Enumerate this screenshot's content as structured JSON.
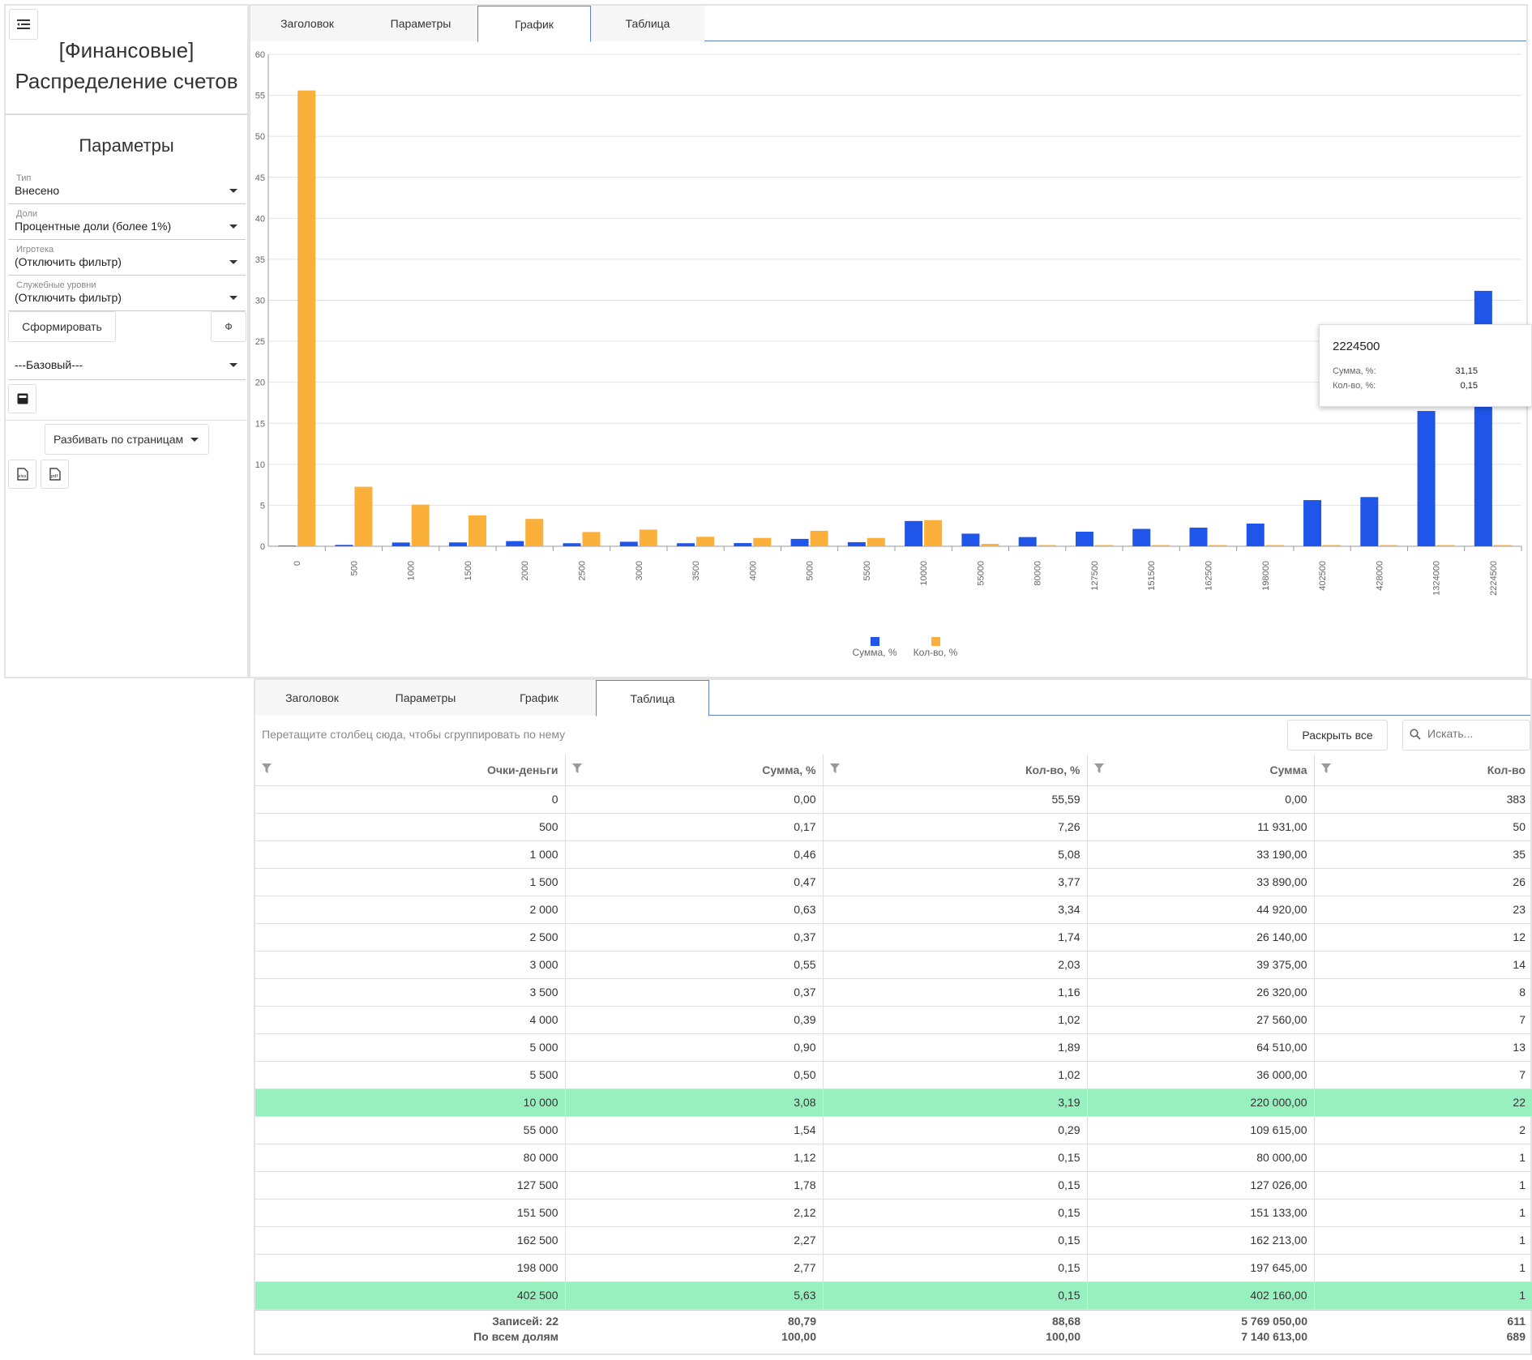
{
  "left": {
    "title_line1": "[Финансовые]",
    "title_line2": "Распределение счетов",
    "params_heading": "Параметры",
    "fields": [
      {
        "label": "Тип",
        "value": "Внесено"
      },
      {
        "label": "Доли",
        "value": "Процентные доли (более 1%)"
      },
      {
        "label": "Игротека",
        "value": "(Отключить фильтр)"
      },
      {
        "label": "Служебные уровни",
        "value": "(Отключить фильтр)"
      }
    ],
    "generate_label": "Сформировать",
    "phi_label": "Ф",
    "preset_value": "---Базовый---",
    "paging_label": "Разбивать по страницам"
  },
  "tabs": [
    "Заголовок",
    "Параметры",
    "График",
    "Таблица"
  ],
  "chart_data": {
    "type": "bar",
    "categories": [
      "0",
      "500",
      "1000",
      "1500",
      "2000",
      "2500",
      "3000",
      "3500",
      "4000",
      "5000",
      "5500",
      "10000",
      "55000",
      "80000",
      "127500",
      "151500",
      "162500",
      "198000",
      "402500",
      "428000",
      "1324000",
      "2224500"
    ],
    "series": [
      {
        "name": "Сумма, %",
        "color": "#1f55e8",
        "values": [
          0,
          0.17,
          0.46,
          0.47,
          0.63,
          0.37,
          0.55,
          0.37,
          0.39,
          0.9,
          0.5,
          3.08,
          1.54,
          1.12,
          1.78,
          2.12,
          2.27,
          2.77,
          5.63,
          6.0,
          16.5,
          31.15
        ]
      },
      {
        "name": "Кол-во, %",
        "color": "#fbb03b",
        "values": [
          55.59,
          7.26,
          5.08,
          3.77,
          3.34,
          1.74,
          2.03,
          1.16,
          1.02,
          1.89,
          1.02,
          3.19,
          0.29,
          0.15,
          0.15,
          0.15,
          0.15,
          0.15,
          0.15,
          0.15,
          0.15,
          0.15
        ]
      }
    ],
    "ylim": [
      0,
      60
    ],
    "yticks": [
      0,
      5,
      10,
      15,
      20,
      25,
      30,
      35,
      40,
      45,
      50,
      55,
      60
    ],
    "legend": "bottom-center",
    "grid": true
  },
  "tooltip": {
    "title": "2224500",
    "rows": [
      {
        "label": "Сумма, %:",
        "value": "31,15"
      },
      {
        "label": "Кол-во, %:",
        "value": "0,15"
      }
    ]
  },
  "table": {
    "group_hint": "Перетащите столбец сюда, чтобы сгруппировать по нему",
    "expand_label": "Раскрыть все",
    "search_placeholder": "Искать...",
    "columns": [
      "Очки-деньги",
      "Сумма, %",
      "Кол-во, %",
      "Сумма",
      "Кол-во"
    ],
    "rows": [
      [
        "0",
        "0,00",
        "55,59",
        "0,00",
        "383"
      ],
      [
        "500",
        "0,17",
        "7,26",
        "11 931,00",
        "50"
      ],
      [
        "1 000",
        "0,46",
        "5,08",
        "33 190,00",
        "35"
      ],
      [
        "1 500",
        "0,47",
        "3,77",
        "33 890,00",
        "26"
      ],
      [
        "2 000",
        "0,63",
        "3,34",
        "44 920,00",
        "23"
      ],
      [
        "2 500",
        "0,37",
        "1,74",
        "26 140,00",
        "12"
      ],
      [
        "3 000",
        "0,55",
        "2,03",
        "39 375,00",
        "14"
      ],
      [
        "3 500",
        "0,37",
        "1,16",
        "26 320,00",
        "8"
      ],
      [
        "4 000",
        "0,39",
        "1,02",
        "27 560,00",
        "7"
      ],
      [
        "5 000",
        "0,90",
        "1,89",
        "64 510,00",
        "13"
      ],
      [
        "5 500",
        "0,50",
        "1,02",
        "36 000,00",
        "7"
      ],
      [
        "10 000",
        "3,08",
        "3,19",
        "220 000,00",
        "22"
      ],
      [
        "55 000",
        "1,54",
        "0,29",
        "109 615,00",
        "2"
      ],
      [
        "80 000",
        "1,12",
        "0,15",
        "80 000,00",
        "1"
      ],
      [
        "127 500",
        "1,78",
        "0,15",
        "127 026,00",
        "1"
      ],
      [
        "151 500",
        "2,12",
        "0,15",
        "151 133,00",
        "1"
      ],
      [
        "162 500",
        "2,27",
        "0,15",
        "162 213,00",
        "1"
      ],
      [
        "198 000",
        "2,77",
        "0,15",
        "197 645,00",
        "1"
      ],
      [
        "402 500",
        "5,63",
        "0,15",
        "402 160,00",
        "1"
      ]
    ],
    "highlighted_rows": [
      11,
      18
    ],
    "footer": {
      "records_label": "Записей: 22",
      "all_label": "По всем долям",
      "sum_pct": [
        "80,79",
        "100,00"
      ],
      "cnt_pct": [
        "88,68",
        "100,00"
      ],
      "sum": [
        "5 769 050,00",
        "7 140 613,00"
      ],
      "cnt": [
        "611",
        "689"
      ]
    }
  },
  "colors": {
    "blue": "#1f55e8",
    "orange": "#fbb03b",
    "highlight": "#99f0bf",
    "tab_border": "#5b7fd3"
  }
}
